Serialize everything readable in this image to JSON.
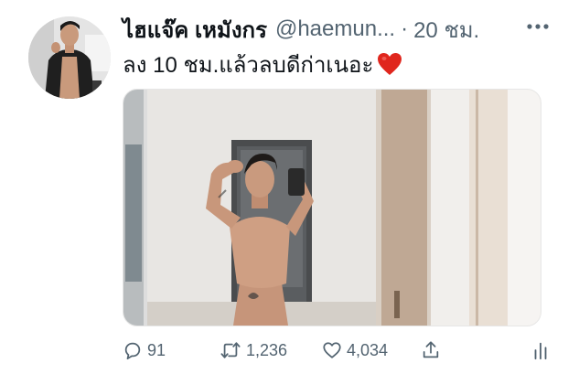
{
  "tweet": {
    "author_name": "ไฮแจ๊ค เหมังกร",
    "handle": "@haemun...",
    "separator": "·",
    "time": "20 ชม.",
    "more_icon": "more-horizontal-icon",
    "text": "ลง 10 ชม.แล้วลบดีก่าเนอะ",
    "text_emoji": "red-heart",
    "media_alt": "mirror selfie photo"
  },
  "actions": {
    "reply": {
      "icon": "reply-icon",
      "count": "91"
    },
    "retweet": {
      "icon": "retweet-icon",
      "count": "1,236"
    },
    "like": {
      "icon": "like-heart-icon",
      "count": "4,034"
    },
    "share": {
      "icon": "share-icon"
    },
    "analytics": {
      "icon": "analytics-icon"
    }
  },
  "colors": {
    "text_primary": "#0f1419",
    "text_secondary": "#536471",
    "heart_red": "#e0261d"
  }
}
